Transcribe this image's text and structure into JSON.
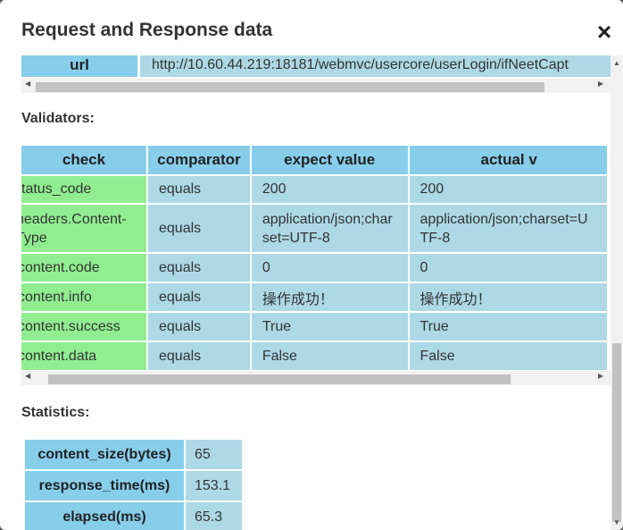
{
  "dialog": {
    "title": "Request and Response data",
    "close_icon": "×"
  },
  "url_row": {
    "label": "url",
    "value": "http://10.60.44.219:18181/webmvc/usercore/userLogin/ifNeetCapt"
  },
  "validators": {
    "heading": "Validators:",
    "columns": [
      "check",
      "comparator",
      "expect value",
      "actual v"
    ],
    "rows": [
      {
        "check": "status_code",
        "comparator": "equals",
        "expect": "200",
        "actual": "200"
      },
      {
        "check": "headers.Content-Type",
        "comparator": "equals",
        "expect": "application/json;charset=UTF-8",
        "actual": "application/json;charset=UTF-8"
      },
      {
        "check": "content.code",
        "comparator": "equals",
        "expect": "0",
        "actual": "0"
      },
      {
        "check": "content.info",
        "comparator": "equals",
        "expect": "操作成功！",
        "actual": "操作成功！"
      },
      {
        "check": "content.success",
        "comparator": "equals",
        "expect": "True",
        "actual": "True"
      },
      {
        "check": "content.data",
        "comparator": "equals",
        "expect": "False",
        "actual": "False"
      }
    ]
  },
  "statistics": {
    "heading": "Statistics:",
    "rows": [
      {
        "label": "content_size(bytes)",
        "value": "65"
      },
      {
        "label": "response_time(ms)",
        "value": "153.1"
      },
      {
        "label": "elapsed(ms)",
        "value": "65.3"
      }
    ]
  },
  "icons": {
    "arrow_left": "◀",
    "arrow_right": "▶",
    "arrow_up": "▲",
    "arrow_down": "▼"
  },
  "colors": {
    "header_cell": "#87ceeb",
    "value_cell": "#add8e6",
    "check_cell": "#90ee90"
  }
}
